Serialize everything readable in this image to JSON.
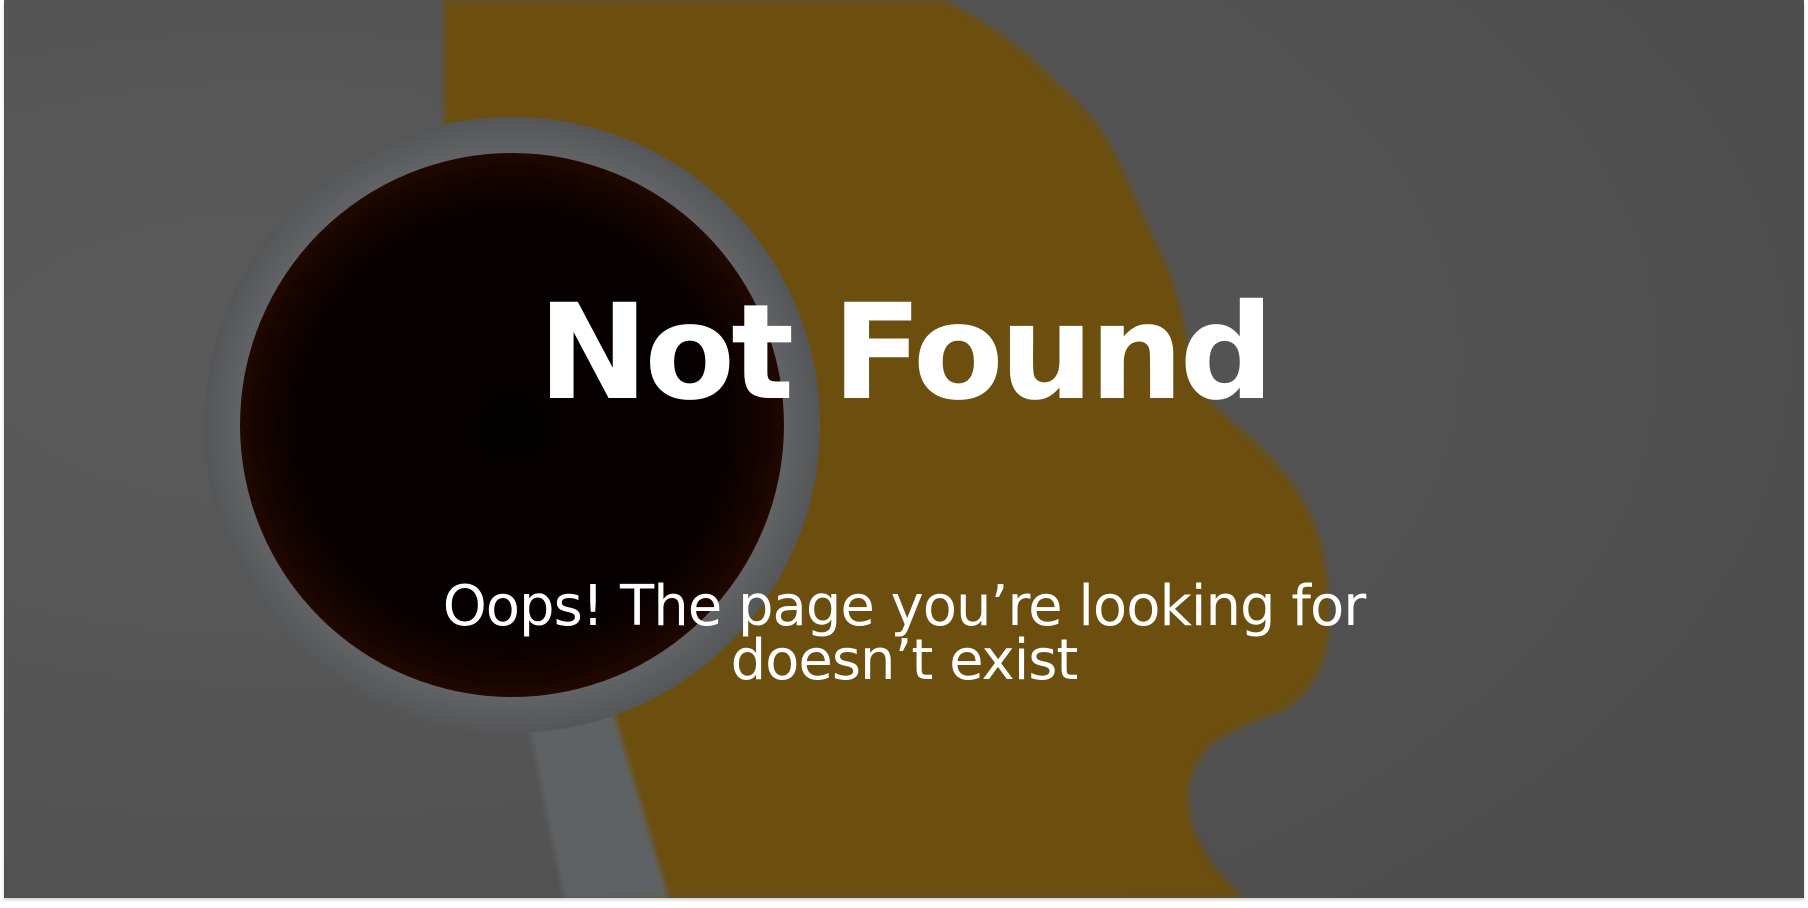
{
  "error_page": {
    "title": "Not Found",
    "message": "Oops! The page you’re looking for doesn’t exist"
  },
  "background": {
    "image": "coffee-mug-spill-photo",
    "overlay_color": "#000000"
  }
}
